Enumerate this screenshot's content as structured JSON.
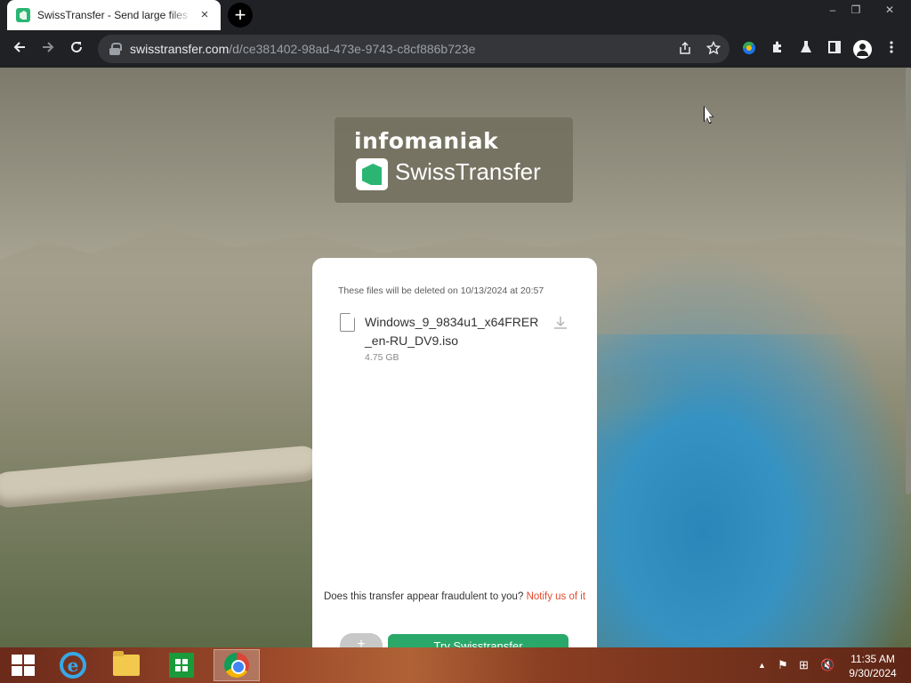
{
  "browser": {
    "tab_title": "SwissTransfer - Send large files",
    "tab_close": "×",
    "new_tab": "+",
    "url_host": "swisstransfer.com",
    "url_path": "/d/ce381402-98ad-473e-9743-c8cf886b723e",
    "window_controls": [
      "–",
      "❐",
      "✕"
    ]
  },
  "page": {
    "brand": "infomaniak",
    "product": "SwissTransfer",
    "expiry_text": "These files will be deleted on 10/13/2024 at 20:57",
    "file": {
      "name": "Windows_9_9834u1_x64FRER_en-RU_DV9.iso",
      "size": "4.75 GB"
    },
    "fraud_question": "Does this transfer appear fraudulent to you?",
    "notify_link": "Notify us of it",
    "try_button": "Try Swisstransfer",
    "secondary_button": "+"
  },
  "taskbar": {
    "time": "11:35 AM",
    "date": "9/30/2024",
    "tray_up": "▲",
    "tray_flag": "⚑",
    "tray_network": "⊞",
    "tray_volume": "🔇"
  },
  "colors": {
    "accent_green": "#2aa86a",
    "link_red": "#e04a2e",
    "chrome_dark": "#202124"
  }
}
